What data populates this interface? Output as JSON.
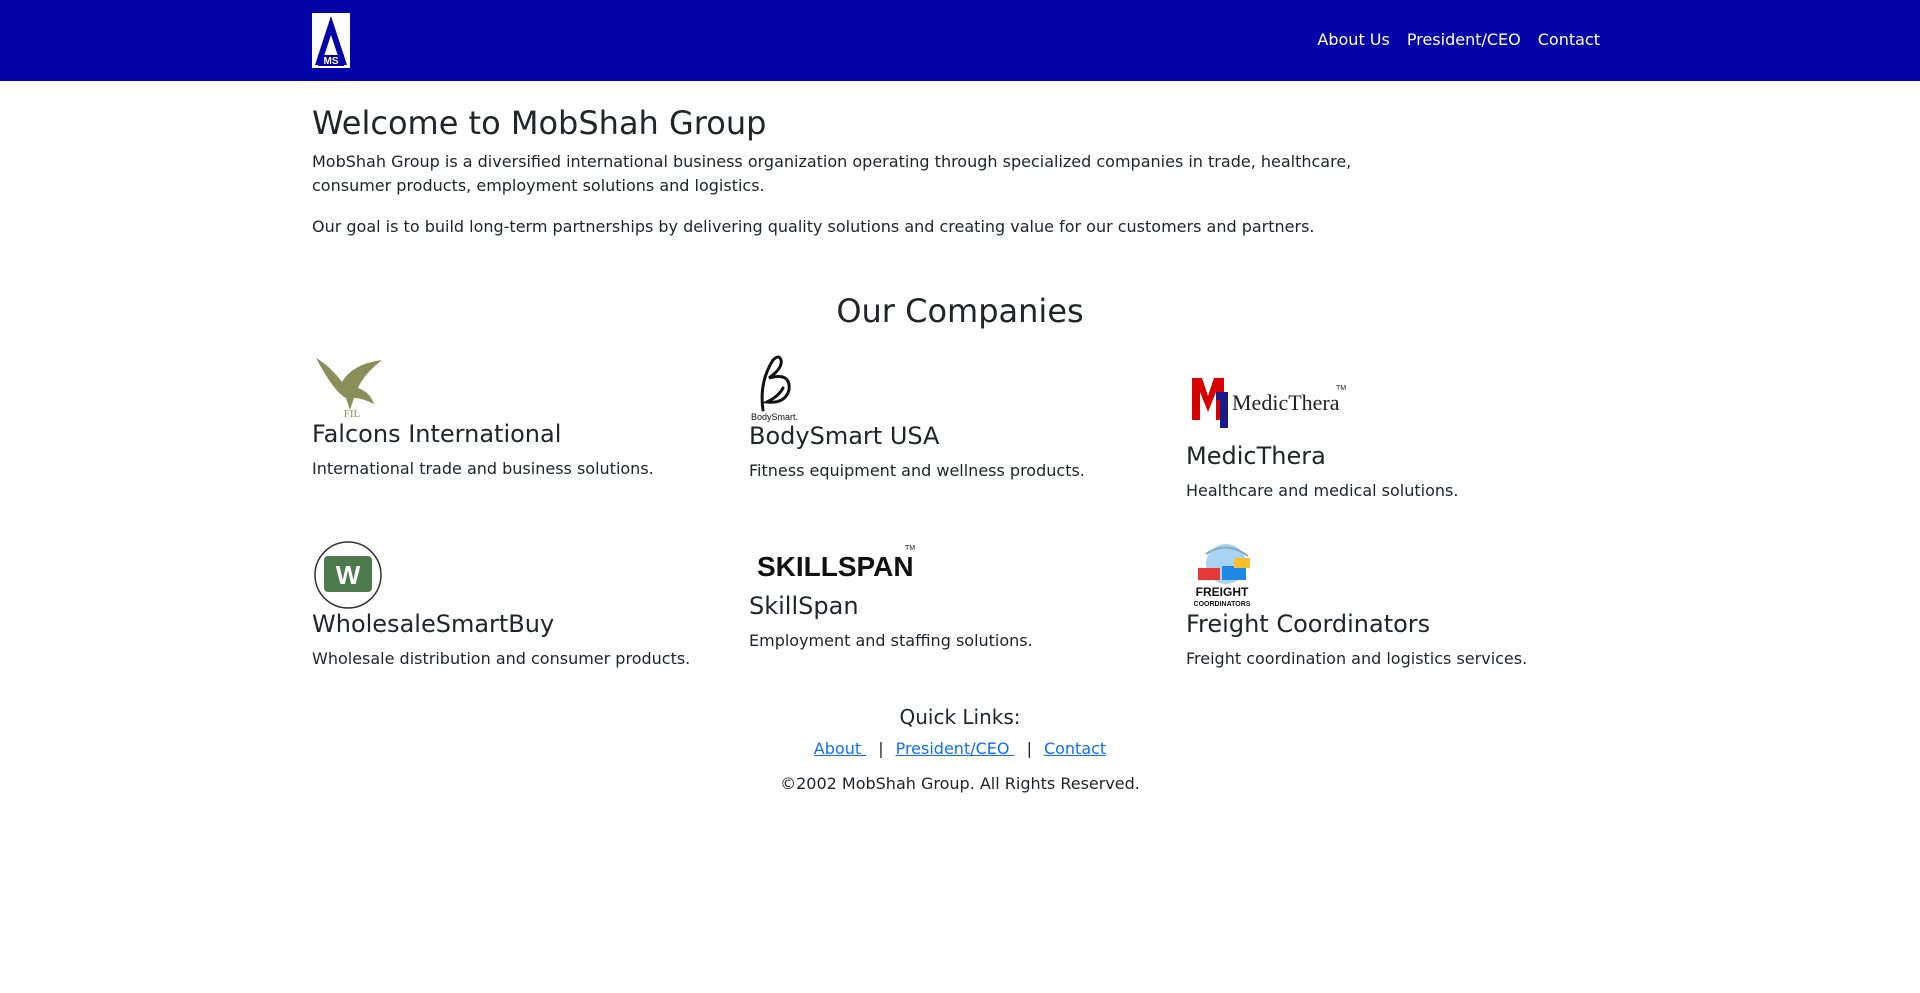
{
  "nav": {
    "logo_text": "MS",
    "links": [
      "About Us",
      "President/CEO",
      "Contact"
    ],
    "colors": {
      "navbar_bg": "#0404a8",
      "link": "#ffffff"
    }
  },
  "intro": {
    "title": "Welcome to MobShah Group",
    "paragraph1": "MobShah Group is a diversified international business organization operating through specialized companies in trade, healthcare, consumer products, employment solutions and logistics.",
    "paragraph2": "Our goal is to build long-term partnerships by delivering quality solutions and creating value for our customers and partners."
  },
  "companies": {
    "title": "Our Companies",
    "items": [
      {
        "name": "Falcons International",
        "description": "International trade and business solutions.",
        "logo_icon": "falcon-logo-icon",
        "logo_text": "FIL"
      },
      {
        "name": "BodySmart USA",
        "description": "Fitness equipment and wellness products.",
        "logo_icon": "bodysmart-logo-icon",
        "logo_text": "BodySmart."
      },
      {
        "name": "MedicThera",
        "description": "Healthcare and medical solutions.",
        "logo_icon": "medicthera-logo-icon",
        "logo_text": "MedicThera"
      },
      {
        "name": "WholesaleSmartBuy",
        "description": "Wholesale distribution and consumer products.",
        "logo_icon": "wholesale-logo-icon",
        "logo_text": "W"
      },
      {
        "name": "SkillSpan",
        "description": "Employment and staffing solutions.",
        "logo_icon": "skillspan-logo-icon",
        "logo_text": "SKILLSPAN"
      },
      {
        "name": "Freight Coordinators",
        "description": "Freight coordination and logistics services.",
        "logo_icon": "freight-logo-icon",
        "logo_text": "FREIGHT COORDINATORS"
      }
    ]
  },
  "footer": {
    "quick_links_title": "Quick Links:",
    "links": [
      "About ",
      "President/CEO ",
      "Contact"
    ],
    "separator": "|",
    "copyright": "©2002 MobShah Group. All Rights Reserved.",
    "link_color": "#0d6efd"
  }
}
